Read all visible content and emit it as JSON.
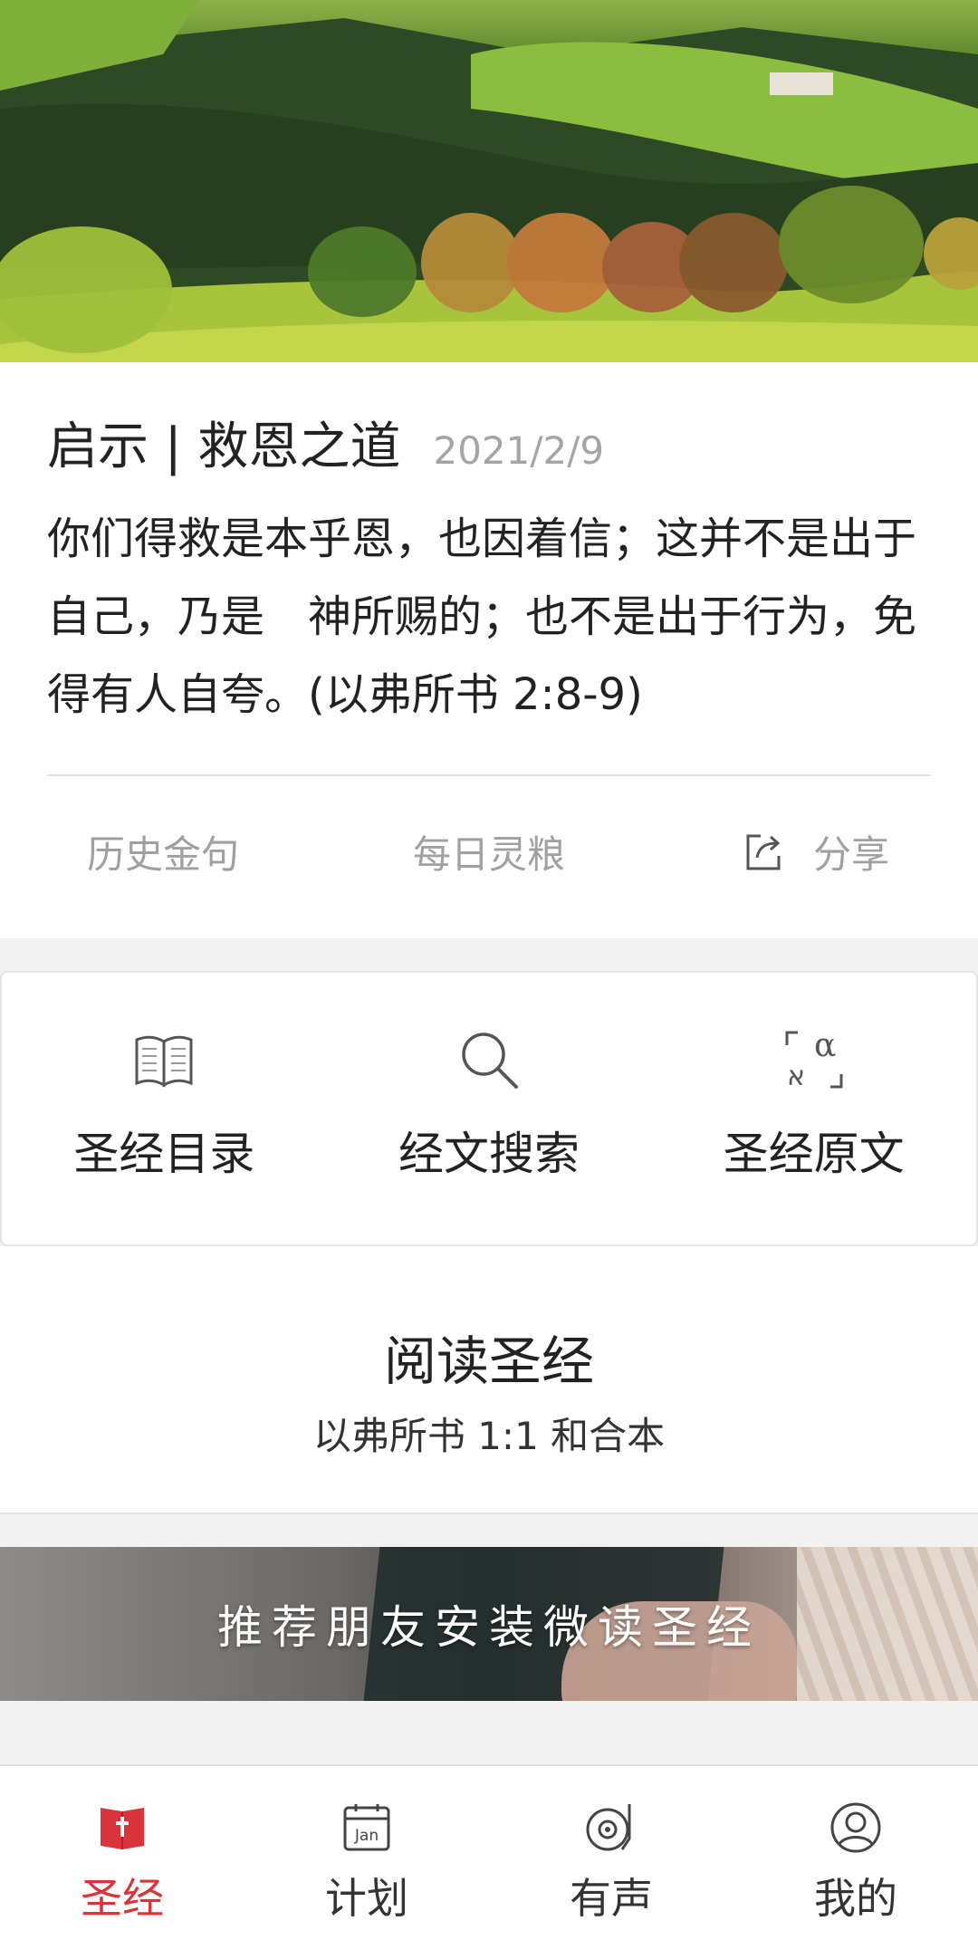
{
  "verse": {
    "title": "启示 | 救恩之道",
    "date": "2021/2/9",
    "text": "你们得救是本乎恩，也因着信；这并不是出于自己，乃是　神所赐的；也不是出于行为，免得有人自夸。(以弗所书 2:8-9)",
    "actions": {
      "history": "历史金句",
      "daily": "每日灵粮",
      "share": "分享"
    }
  },
  "tools": [
    {
      "label": "圣经目录",
      "icon": "open-book-icon"
    },
    {
      "label": "经文搜索",
      "icon": "search-icon"
    },
    {
      "label": "圣经原文",
      "icon": "original-language-icon"
    }
  ],
  "read": {
    "title": "阅读圣经",
    "subtitle": "以弗所书 1:1 和合本"
  },
  "banner": {
    "text": "推荐朋友安装微读圣经"
  },
  "nav": [
    {
      "label": "圣经",
      "icon": "bible-icon",
      "active": true
    },
    {
      "label": "计划",
      "icon": "calendar-icon",
      "badge": "Jan",
      "active": false
    },
    {
      "label": "有声",
      "icon": "record-player-icon",
      "active": false
    },
    {
      "label": "我的",
      "icon": "profile-icon",
      "active": false
    }
  ],
  "colors": {
    "accent": "#d9343a",
    "muted_text": "#a0a0a0",
    "background": "#f2f2f2"
  }
}
